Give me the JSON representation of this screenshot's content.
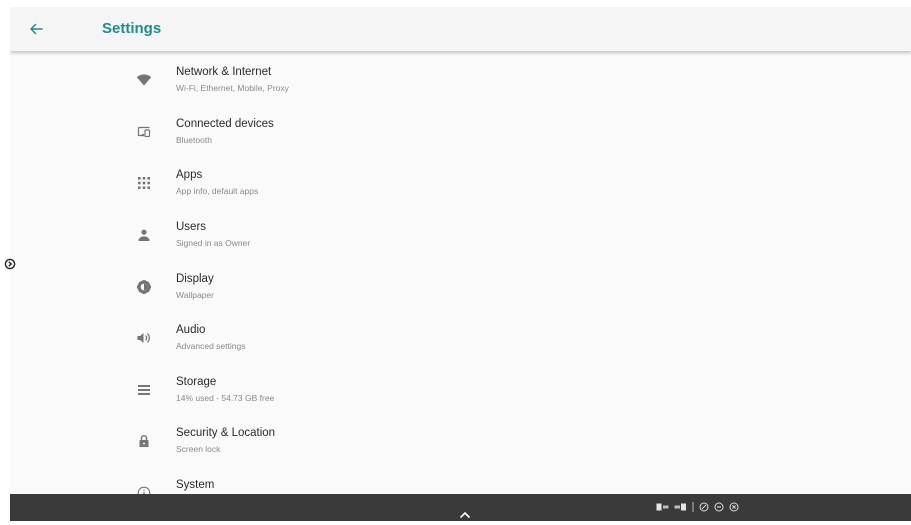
{
  "app_bar": {
    "title": "Settings",
    "back_icon": "arrow-back-icon"
  },
  "colors": {
    "accent": "#1e8e8a",
    "background": "#fafafa",
    "nav_bar": "#3a3a3a",
    "icon": "#757575"
  },
  "settings": {
    "items": [
      {
        "title": "Network & Internet",
        "summary": "Wi-Fi, Ethernet, Mobile, Proxy",
        "icon": "wifi-icon"
      },
      {
        "title": "Connected devices",
        "summary": "Bluetooth",
        "icon": "devices-icon"
      },
      {
        "title": "Apps",
        "summary": "App info, default apps",
        "icon": "apps-grid-icon"
      },
      {
        "title": "Users",
        "summary": "Signed in as Owner",
        "icon": "person-icon"
      },
      {
        "title": "Display",
        "summary": "Wallpaper",
        "icon": "brightness-icon"
      },
      {
        "title": "Audio",
        "summary": "Advanced settings",
        "icon": "volume-icon"
      },
      {
        "title": "Storage",
        "summary": "14% used - 54.73 GB free",
        "icon": "storage-icon"
      },
      {
        "title": "Security & Location",
        "summary": "Screen lock",
        "icon": "lock-icon"
      },
      {
        "title": "System",
        "summary": "",
        "icon": "info-icon"
      }
    ]
  },
  "nav_bar": {
    "center_icon": "chevron-up-icon",
    "tray_icons": [
      "window-left-icon",
      "window-right-icon",
      "screenshot-icon",
      "minimize-icon",
      "close-circle-icon"
    ]
  }
}
